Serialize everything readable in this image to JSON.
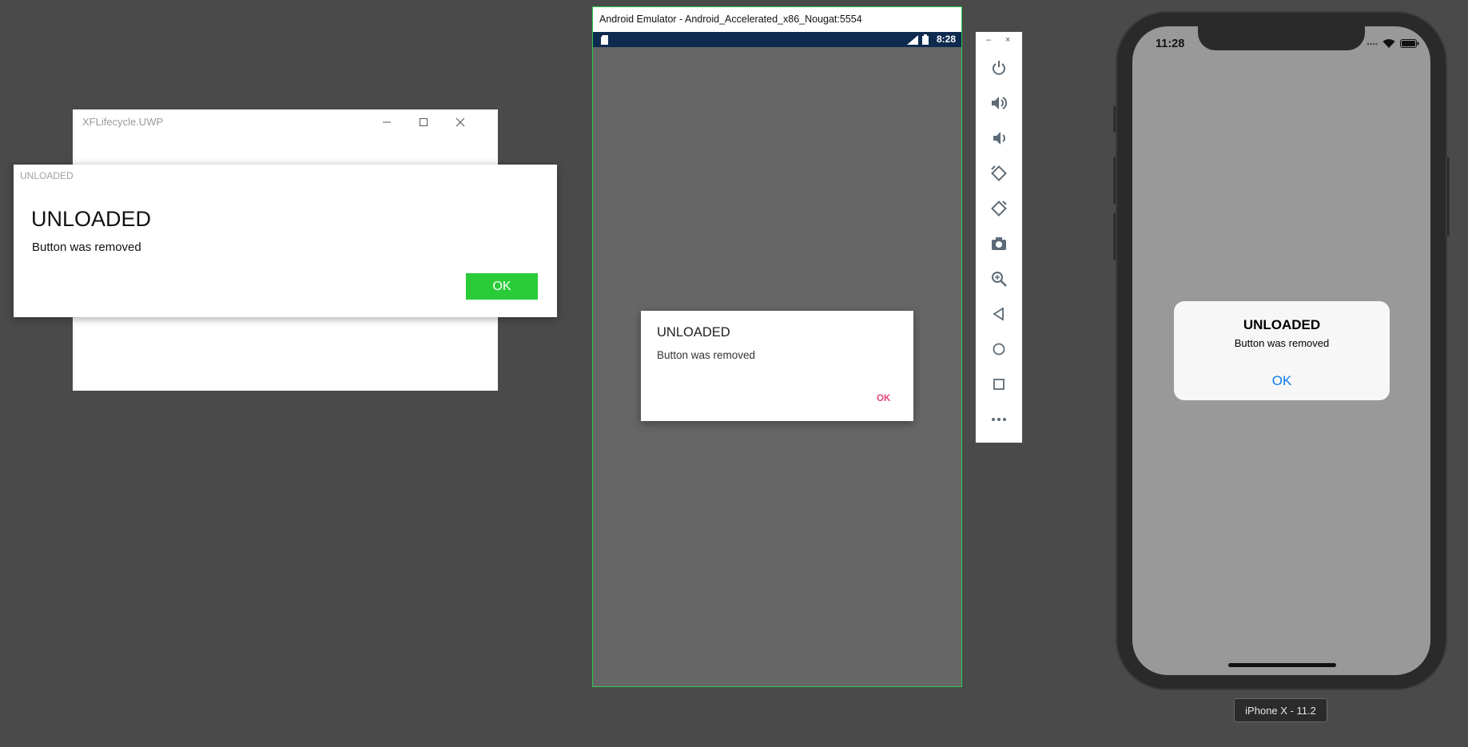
{
  "uwp": {
    "window_title": "XFLifecycle.UWP",
    "dialog_caption": "UNLOADED",
    "dialog_heading": "UNLOADED",
    "dialog_message": "Button was removed",
    "ok_label": "OK"
  },
  "android": {
    "window_title": "Android Emulator - Android_Accelerated_x86_Nougat:5554",
    "clock": "8:28",
    "dialog_title": "UNLOADED",
    "dialog_message": "Button was removed",
    "ok_label": "OK",
    "toolbar_icons": [
      "power-icon",
      "volume-up-icon",
      "volume-down-icon",
      "rotate-left-icon",
      "rotate-right-icon",
      "camera-icon",
      "zoom-icon",
      "back-icon",
      "home-icon",
      "overview-icon",
      "more-icon"
    ]
  },
  "ios": {
    "clock": "11:28",
    "alert_title": "UNLOADED",
    "alert_message": "Button was removed",
    "ok_label": "OK",
    "device_label": "iPhone X - 11.2"
  },
  "colors": {
    "background": "#4a4a4a",
    "uwp_accent": "#29cc37",
    "android_accent": "#e0457b",
    "android_statusbar": "#0e2a4f",
    "ios_accent": "#0a7bf5"
  }
}
